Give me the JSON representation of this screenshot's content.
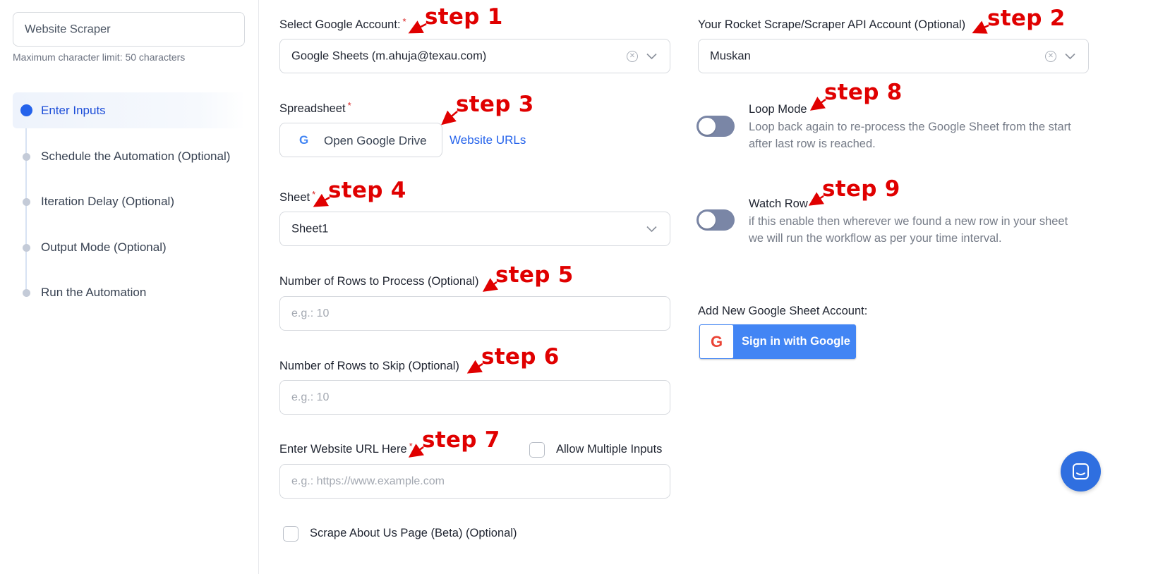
{
  "sidebar": {
    "name_input_value": "Website Scraper",
    "char_limit_note": "Maximum character limit: 50 characters",
    "steps": [
      {
        "label": "Enter Inputs"
      },
      {
        "label": "Schedule the Automation (Optional)"
      },
      {
        "label": "Iteration Delay (Optional)"
      },
      {
        "label": "Output Mode (Optional)"
      },
      {
        "label": "Run the Automation"
      }
    ]
  },
  "form": {
    "google_account": {
      "label": "Select Google Account:",
      "value": "Google Sheets (m.ahuja@texau.com)",
      "required": "*"
    },
    "spreadsheet": {
      "label": "Spreadsheet",
      "required": "*",
      "button": "Open Google Drive",
      "selected": "Website URLs"
    },
    "sheet": {
      "label": "Sheet",
      "required": "*",
      "value": "Sheet1"
    },
    "rows_to_process": {
      "label": "Number of Rows to Process (Optional)",
      "placeholder": "e.g.: 10"
    },
    "rows_to_skip": {
      "label": "Number of Rows to Skip (Optional)",
      "placeholder": "e.g.: 10"
    },
    "website_url": {
      "label": "Enter Website URL Here",
      "required": "*",
      "placeholder": "e.g.: https://www.example.com",
      "allow_multiple": "Allow Multiple Inputs"
    },
    "scrape_about": {
      "label": "Scrape About Us Page (Beta) (Optional)"
    }
  },
  "right": {
    "api_account": {
      "label": "Your Rocket Scrape/Scraper API Account (Optional)",
      "value": "Muskan"
    },
    "loop_mode": {
      "title": "Loop Mode",
      "desc_line1": "Loop back again to re-process the Google Sheet from the start",
      "desc_line2": "after last row is reached."
    },
    "watch_row": {
      "title": "Watch Row",
      "desc_line1": "if this enable then wherever we found a new row in your sheet",
      "desc_line2": "we will run the workflow as per your time interval."
    },
    "add_account": {
      "label": "Add New Google Sheet Account:",
      "button": "Sign in with Google"
    }
  },
  "annotations": {
    "s1": "step 1",
    "s2": "step 2",
    "s3": "step 3",
    "s4": "step 4",
    "s5": "step 5",
    "s6": "step 6",
    "s7": "step 7",
    "s8": "step 8",
    "s9": "step 9"
  },
  "colors": {
    "accent": "#2563eb",
    "annotation": "#e00000",
    "toggle_off": "#7a86a6",
    "google_button": "#4285f4"
  }
}
